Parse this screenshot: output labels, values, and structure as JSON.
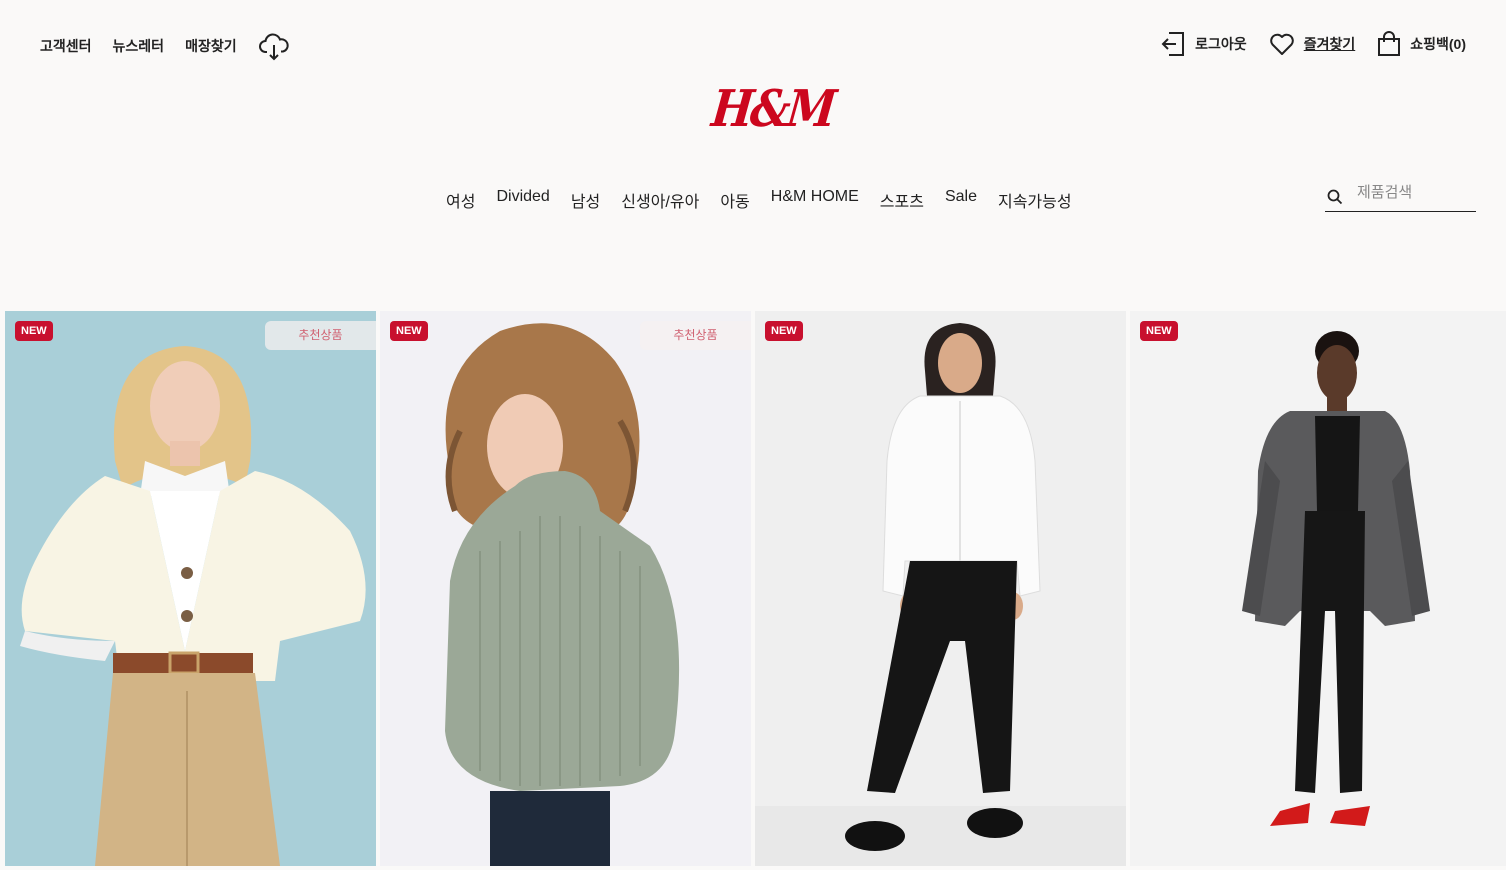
{
  "util_left": {
    "customer_center": "고객센터",
    "newsletter": "뉴스레터",
    "store_finder": "매장찾기",
    "download_icon": "cloud-download-icon"
  },
  "util_right": {
    "logout": "로그아웃",
    "favorites": "즐겨찾기",
    "cart": "쇼핑백(0)"
  },
  "logo": {
    "text": "H&M",
    "color": "#cc071e"
  },
  "nav": {
    "items": [
      "여성",
      "Divided",
      "남성",
      "신생아/유아",
      "아동",
      "H&M HOME",
      "스포츠",
      "Sale",
      "지속가능성"
    ]
  },
  "search": {
    "placeholder": "제품검색",
    "value": ""
  },
  "products": [
    {
      "badge": "NEW",
      "tag": "추천상품",
      "description": "woman in cream cardigan, white shirt and beige trousers"
    },
    {
      "badge": "NEW",
      "tag": "추천상품",
      "description": "woman in sage green chunky knit sweater"
    },
    {
      "badge": "NEW",
      "tag": "",
      "description": "woman in white shirt and black trousers"
    },
    {
      "badge": "NEW",
      "tag": "",
      "description": "woman in grey tweed blazer and black trousers"
    }
  ],
  "colors": {
    "accent": "#cc071e",
    "badge_new": "#c8102e",
    "background": "#faf9f8"
  }
}
